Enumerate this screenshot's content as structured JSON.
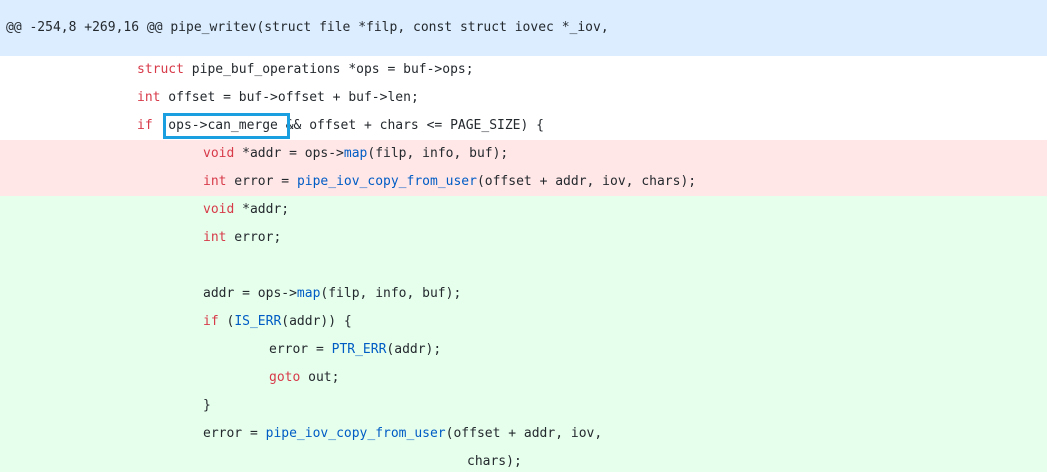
{
  "hunk_header": "@@ -254,8 +269,16 @@ pipe_writev(struct file *filp, const struct iovec *_iov,",
  "highlight_label": "ops->can_merge",
  "lines": [
    {
      "type": "context",
      "indent": 2,
      "tokens": [
        {
          "t": "struct",
          "c": "kw"
        },
        {
          "t": " pipe_buf_operations *ops = buf->ops;"
        }
      ]
    },
    {
      "type": "context",
      "indent": 2,
      "tokens": [
        {
          "t": "int",
          "c": "kw"
        },
        {
          "t": " offset = buf->offset + buf->len;"
        }
      ]
    },
    {
      "type": "context",
      "indent": 2,
      "tokens": [
        {
          "t": "if",
          "c": "kw"
        },
        {
          "t": " (ops->can_merge && offset + chars <= PAGE_SIZE) {"
        }
      ]
    },
    {
      "type": "del",
      "indent": 3,
      "tokens": [
        {
          "t": "void",
          "c": "kw"
        },
        {
          "t": " *addr = ops->"
        },
        {
          "t": "map",
          "c": "fn"
        },
        {
          "t": "(filp, info, buf);"
        }
      ]
    },
    {
      "type": "del",
      "indent": 3,
      "tokens": [
        {
          "t": "int",
          "c": "kw"
        },
        {
          "t": " error = "
        },
        {
          "t": "pipe_iov_copy_from_user",
          "c": "fn"
        },
        {
          "t": "(offset + addr, iov, chars);"
        }
      ]
    },
    {
      "type": "add",
      "indent": 3,
      "tokens": [
        {
          "t": "void",
          "c": "kw"
        },
        {
          "t": " *addr;"
        }
      ]
    },
    {
      "type": "add",
      "indent": 3,
      "tokens": [
        {
          "t": "int",
          "c": "kw"
        },
        {
          "t": " error;"
        }
      ]
    },
    {
      "type": "add",
      "indent": 3,
      "tokens": []
    },
    {
      "type": "add",
      "indent": 3,
      "tokens": [
        {
          "t": "addr = ops->"
        },
        {
          "t": "map",
          "c": "fn"
        },
        {
          "t": "(filp, info, buf);"
        }
      ]
    },
    {
      "type": "add",
      "indent": 3,
      "tokens": [
        {
          "t": "if",
          "c": "kw"
        },
        {
          "t": " ("
        },
        {
          "t": "IS_ERR",
          "c": "fn"
        },
        {
          "t": "(addr)) {"
        }
      ]
    },
    {
      "type": "add",
      "indent": 4,
      "tokens": [
        {
          "t": "error = "
        },
        {
          "t": "PTR_ERR",
          "c": "fn"
        },
        {
          "t": "(addr);"
        }
      ]
    },
    {
      "type": "add",
      "indent": 4,
      "tokens": [
        {
          "t": "goto",
          "c": "kw"
        },
        {
          "t": " out;"
        }
      ]
    },
    {
      "type": "add",
      "indent": 3,
      "tokens": [
        {
          "t": "}"
        }
      ]
    },
    {
      "type": "add",
      "indent": 3,
      "tokens": [
        {
          "t": "error = "
        },
        {
          "t": "pipe_iov_copy_from_user",
          "c": "fn"
        },
        {
          "t": "(offset + addr, iov,"
        }
      ]
    },
    {
      "type": "add",
      "indent": 7,
      "tokens": [
        {
          "t": "chars);"
        }
      ]
    }
  ],
  "colors": {
    "hunk_bg": "#dbedff",
    "del_bg": "#ffe7e7",
    "add_bg": "#e6ffec",
    "keyword": "#d73a49",
    "function": "#005cc5",
    "highlight_border": "#1a9fe0"
  }
}
